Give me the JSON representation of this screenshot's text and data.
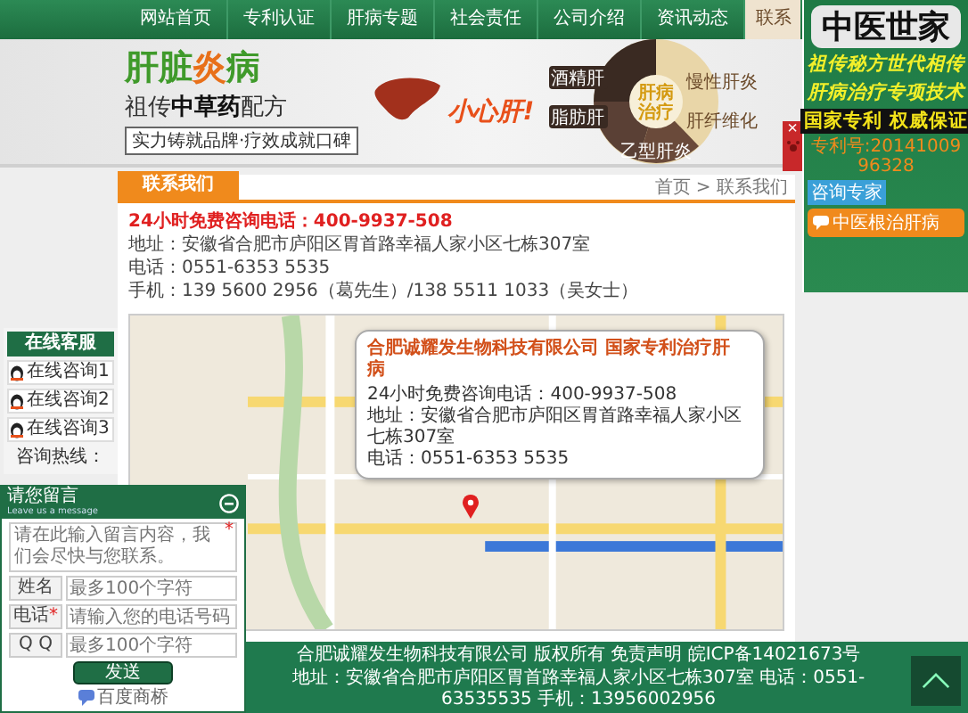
{
  "nav": [
    {
      "label": "网站首页",
      "selected": false
    },
    {
      "label": "专利认证",
      "selected": false
    },
    {
      "label": "肝病专题",
      "selected": false
    },
    {
      "label": "社会责任",
      "selected": false
    },
    {
      "label": "公司介绍",
      "selected": false
    },
    {
      "label": "资讯动态",
      "selected": false
    },
    {
      "label": "联系",
      "selected": true
    }
  ],
  "banner": {
    "headline": [
      {
        "text": "肝脏",
        "color": "#3f9a2a"
      },
      {
        "text": "炎",
        "color": "#e8701a"
      },
      {
        "text": "病",
        "color": "#3f9a2a"
      }
    ],
    "subtitle": "祖传**中草药**配方",
    "slogan": "实力铸就品牌·疗效成就口碑",
    "liver_caption": "小心肝!",
    "wheel": {
      "center": [
        "肝病",
        "治疗"
      ],
      "segments": [
        "酒精肝",
        "慢性肝炎",
        "脂肪肝",
        "肝纤维化",
        "乙型肝炎"
      ]
    }
  },
  "content": {
    "tab": "联系我们",
    "breadcrumb": "首页 > 联系我们",
    "hotline": "24小时免费咨询电话：400-9937-508",
    "lines": [
      "地址：安徽省合肥市庐阳区胃首路幸福人家小区七栋307室",
      "电话：0551-6353 5535",
      "手机：139 5600 2956（葛先生）/138 5511 1033（吴女士）"
    ],
    "map_popup": {
      "title": "合肥诚耀发生物科技有限公司 国家专利治疗肝病",
      "lines": [
        "24小时免费咨询电话：400-9937-508",
        "地址：安徽省合肥市庐阳区胃首路幸福人家小区七栋307室",
        "电话：0551-6353 5535"
      ]
    }
  },
  "service": {
    "title": "在线客服",
    "items": [
      "在线咨询1",
      "在线咨询2",
      "在线咨询3"
    ],
    "hotline_label": "咨询热线："
  },
  "message": {
    "title": "请您留言",
    "subtitle": "Leave us a message",
    "placeholder": "请在此输入留言内容，我们会尽快与您联系。",
    "required_mark": "*",
    "fields": [
      {
        "label": "姓名",
        "placeholder": "最多100个字符"
      },
      {
        "label": "电话",
        "placeholder": "请输入您的电话号码",
        "required_mark": "*"
      },
      {
        "label": "Q Q",
        "placeholder": "最多100个字符"
      }
    ],
    "button": "发送",
    "brand": "百度商桥"
  },
  "ad": {
    "logo": "中医世家",
    "slogans": [
      "祖传秘方世代相传",
      "肝病治疗专项技术"
    ],
    "guarantee": "国家专利 权威保证",
    "patent": "专利号:2014100996328",
    "consult": "咨询专家",
    "bar": "中医根治肝病",
    "close": "×"
  },
  "footer": {
    "lines": [
      "合肥诚耀发生物科技有限公司  版权所有  免责声明  皖ICP备14021673号",
      "地址：安徽省合肥市庐阳区胃首路幸福人家小区七栋307室  电话：0551-63535535 手机：13956002956"
    ]
  }
}
